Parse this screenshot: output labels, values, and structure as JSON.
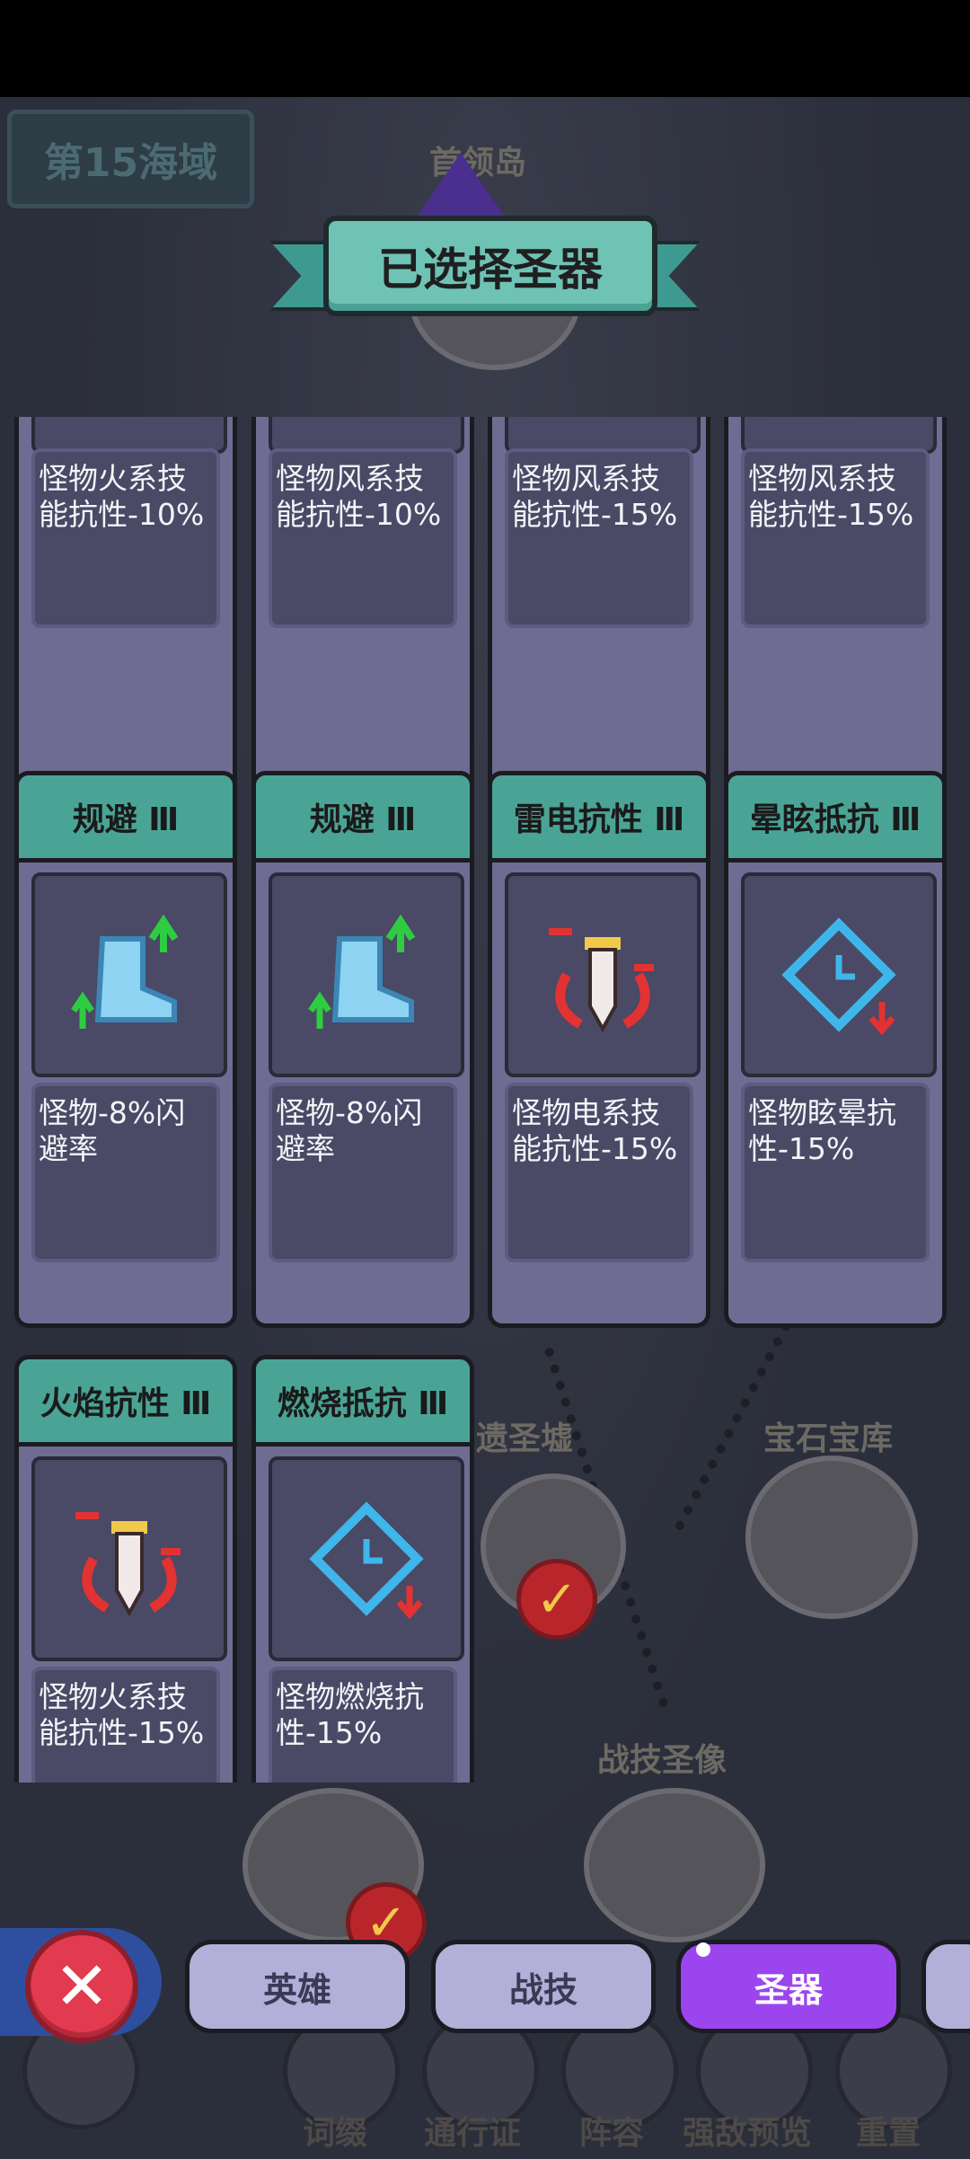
{
  "zone_label": "第15海域",
  "map": {
    "top_island_label": "首领岛",
    "node_sacred_ruins": "遗圣墟",
    "node_gem_vault": "宝石宝库",
    "node_skill_statue": "战技圣像"
  },
  "banner_title": "已选择圣器",
  "cards": [
    {
      "title": "",
      "desc": "怪物火系技能抗性-10%",
      "icon": "sword-icon"
    },
    {
      "title": "",
      "desc": "怪物风系技能抗性-10%",
      "icon": "sword-icon"
    },
    {
      "title": "",
      "desc": "怪物风系技能抗性-15%",
      "icon": "sword-icon"
    },
    {
      "title": "",
      "desc": "怪物风系技能抗性-15%",
      "icon": "sword-icon"
    },
    {
      "title": "规避 Ⅲ",
      "desc": "怪物-8%闪避率",
      "icon": "boot-icon"
    },
    {
      "title": "规避 Ⅲ",
      "desc": "怪物-8%闪避率",
      "icon": "boot-icon"
    },
    {
      "title": "雷电抗性 Ⅲ",
      "desc": "怪物电系技能抗性-15%",
      "icon": "sword-icon"
    },
    {
      "title": "晕眩抵抗 Ⅲ",
      "desc": "怪物眩晕抗性-15%",
      "icon": "clock-diamond-icon"
    },
    {
      "title": "火焰抗性 Ⅲ",
      "desc": "怪物火系技能抗性-15%",
      "icon": "sword-icon"
    },
    {
      "title": "燃烧抵抗 Ⅲ",
      "desc": "怪物燃烧抗性-15%",
      "icon": "clock-diamond-icon"
    }
  ],
  "tabs": [
    {
      "label": "英雄",
      "active": false
    },
    {
      "label": "战技",
      "active": false
    },
    {
      "label": "圣器",
      "active": true
    }
  ],
  "bottom_menu": [
    "词缀",
    "通行证",
    "阵容",
    "强敌预览",
    "重置"
  ],
  "colors": {
    "accent_active_tab": "#9b45ee",
    "card_header": "#4aa496",
    "card_body": "#6f6c93",
    "close_button": "#e23a4e"
  }
}
